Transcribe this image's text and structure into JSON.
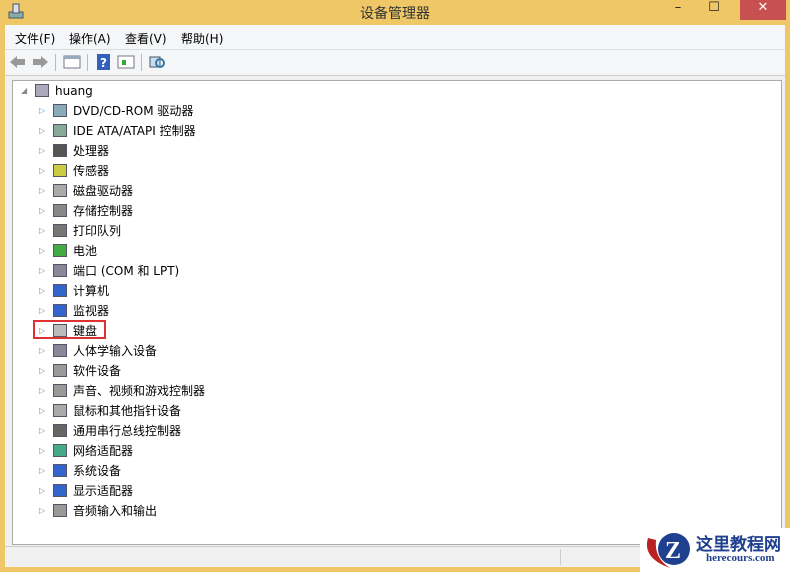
{
  "window": {
    "title": "设备管理器",
    "minimize": "–",
    "maximize": "☐",
    "close": "✕"
  },
  "menu": [
    "文件(F)",
    "操作(A)",
    "查看(V)",
    "帮助(H)"
  ],
  "toolbar": [
    "back-icon",
    "forward-icon",
    "console-tree-icon",
    "help-icon",
    "properties-icon",
    "scan-hardware-icon"
  ],
  "tree": {
    "root": "huang",
    "items": [
      "DVD/CD-ROM 驱动器",
      "IDE ATA/ATAPI 控制器",
      "处理器",
      "传感器",
      "磁盘驱动器",
      "存储控制器",
      "打印队列",
      "电池",
      "端口 (COM 和 LPT)",
      "计算机",
      "监视器",
      "键盘",
      "人体学输入设备",
      "软件设备",
      "声音、视频和游戏控制器",
      "鼠标和其他指针设备",
      "通用串行总线控制器",
      "网络适配器",
      "系统设备",
      "显示适配器",
      "音频输入和输出"
    ],
    "highlighted": "键盘"
  },
  "watermark": {
    "name": "这里教程网",
    "url": "herecours.com"
  },
  "colors": {
    "frame": "#EFC766",
    "close": "#C75050",
    "highlight": "#E03030"
  }
}
